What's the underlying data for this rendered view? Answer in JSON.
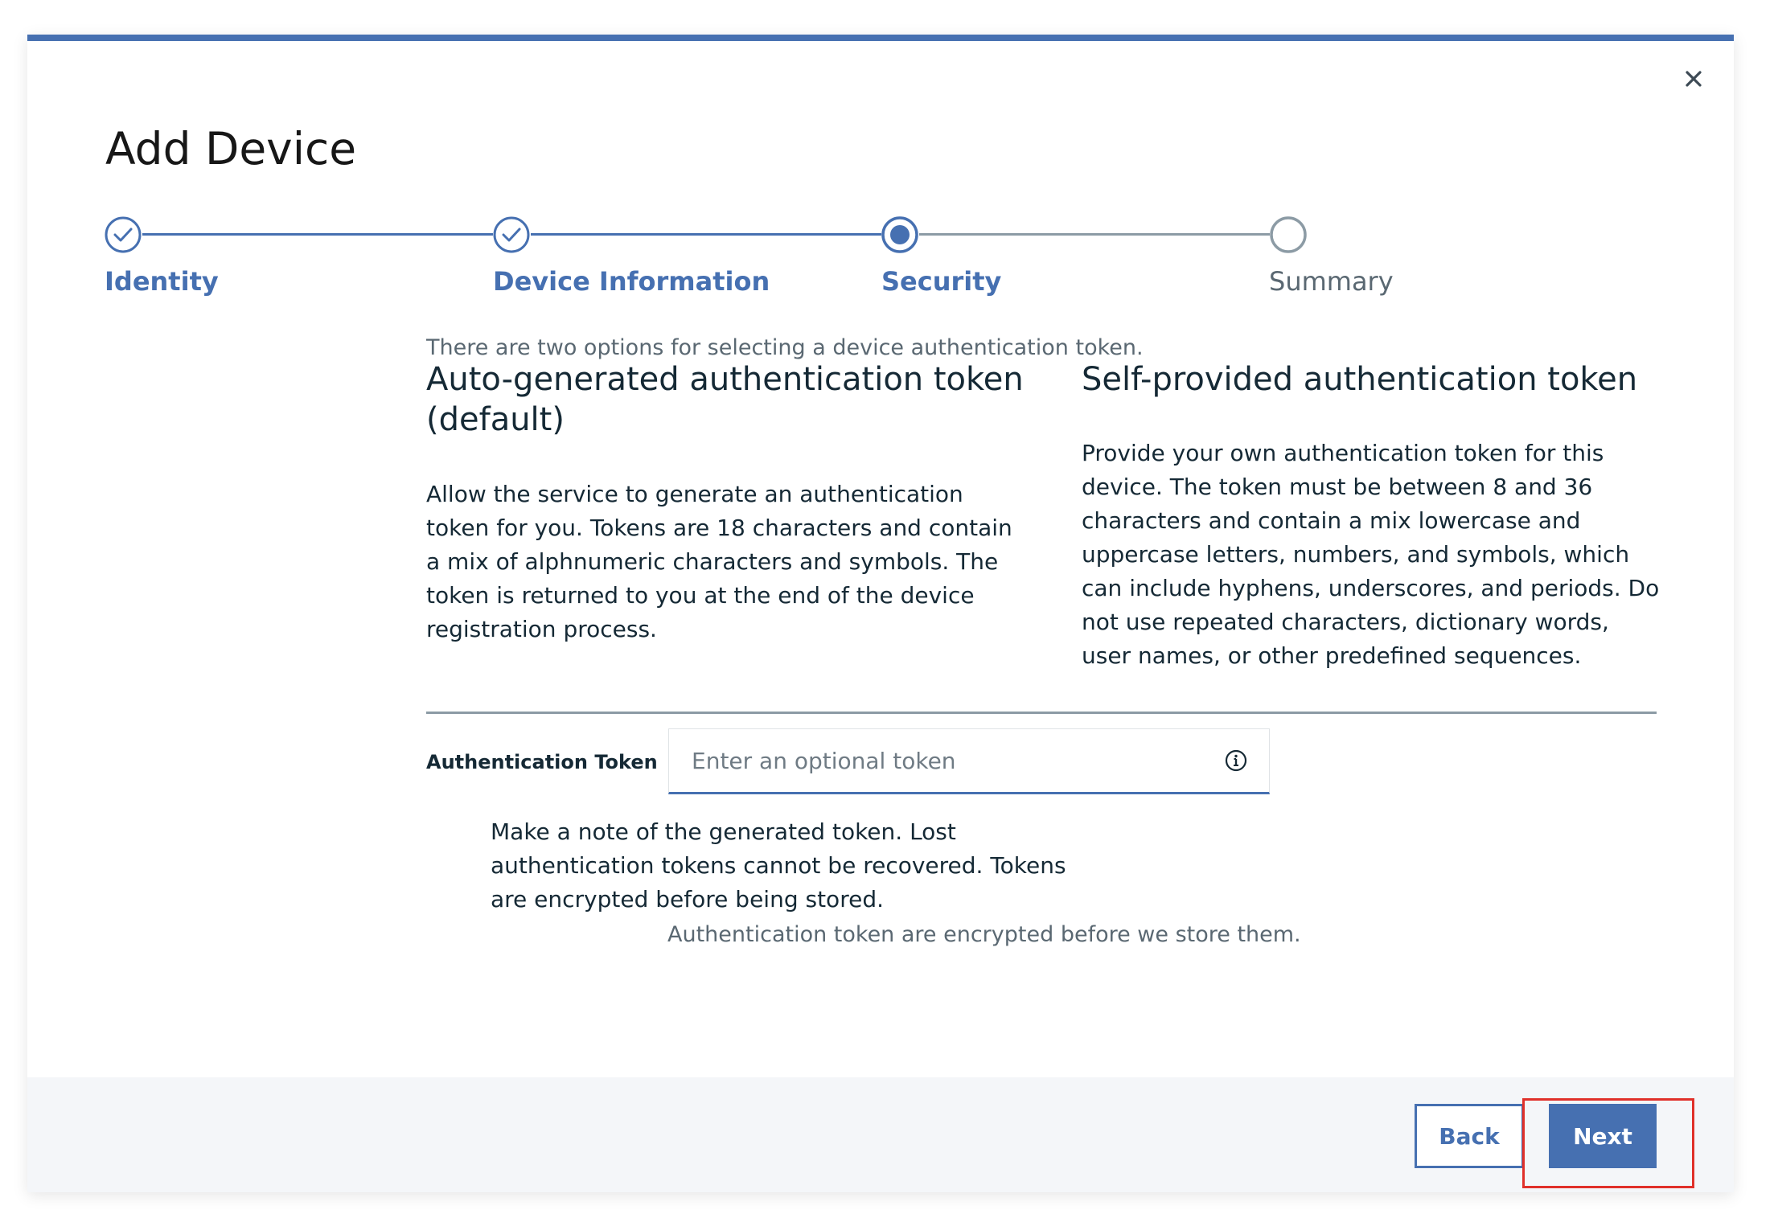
{
  "dialog": {
    "title": "Add Device",
    "close_icon": "close-icon"
  },
  "steps": [
    {
      "label": "Identity",
      "state": "complete"
    },
    {
      "label": "Device Information",
      "state": "complete"
    },
    {
      "label": "Security",
      "state": "current"
    },
    {
      "label": "Summary",
      "state": "incomplete"
    }
  ],
  "security": {
    "intro": "There are two options for selecting a device authentication token.",
    "auto": {
      "heading": "Auto-generated authentication token (default)",
      "text": "Allow the service to generate an authentication token for you. Tokens are 18 characters and contain a mix of alphnumeric characters and symbols. The token is returned to you at the end of the device registration process."
    },
    "self": {
      "heading": "Self-provided authentication token",
      "text": "Provide your own authentication token for this device. The token must be between 8 and 36 characters and contain a mix lowercase and uppercase letters, numbers, and symbols, which can include hyphens, underscores, and periods. Do not use repeated characters, dictionary words, user names, or other predefined sequences."
    },
    "token_field": {
      "label": "Authentication Token",
      "value": "",
      "placeholder": "Enter an optional token",
      "info_icon": "info-icon"
    },
    "note": "Make a note of the generated token. Lost authentication tokens cannot be recovered. Tokens are encrypted before being stored.",
    "helper": "Authentication token are encrypted before we store them."
  },
  "footer": {
    "back_label": "Back",
    "next_label": "Next"
  },
  "colors": {
    "accent": "#4670b1",
    "text": "#152935",
    "muted": "#5a6872",
    "footer_bg": "#f4f6f9",
    "highlight": "#e0302a"
  }
}
